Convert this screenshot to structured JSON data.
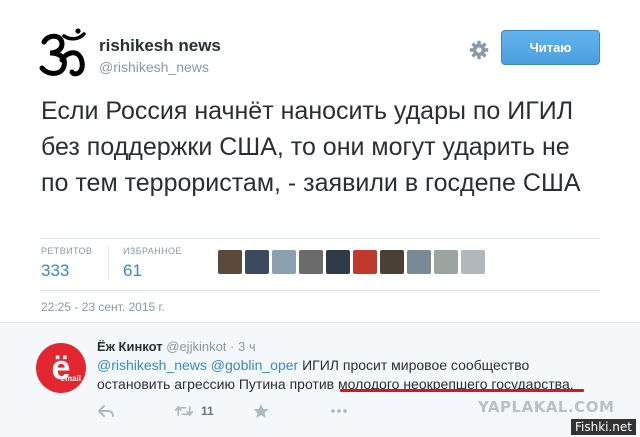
{
  "tweet": {
    "author_name": "rishikesh news",
    "author_handle": "@rishikesh_news",
    "follow_label": "Читаю",
    "text": "Если Россия начнёт наносить удары по ИГИЛ без поддержки США, то они могут ударить не по тем террористам, - заявили в госдепе США",
    "stats": {
      "retweets_label": "РЕТВИТОВ",
      "retweets_value": "333",
      "favorites_label": "ИЗБРАННОЕ",
      "favorites_value": "61"
    },
    "favoriter_avatars": [
      "#5a4a3a",
      "#3b4a5e",
      "#8aa0b0",
      "#6b6b6b",
      "#2f3b48",
      "#c0392b",
      "#4a4035",
      "#7a8a95",
      "#9aa5a0",
      "#b0b8bc"
    ],
    "timestamp": "22:25 - 23 сент. 2015 г."
  },
  "reply": {
    "avatar_letter": "ё",
    "avatar_small": "email",
    "name": "Ёж Кинкот",
    "handle": "@ejjkinkot",
    "time": "· 3 ч",
    "mentions": "@rishikesh_news @goblin_oper",
    "text_line1_rest": " ИГИЛ просит мировое сообщество",
    "text_line2": "остановить агрессию Путина против молодого неокрепшего государства.",
    "retweet_count": "11"
  },
  "watermark": "YAPLAKAL.COM",
  "site_badge": "Fishki.net",
  "colors": {
    "link": "#3b88c3",
    "follow_button": "#4a9fe0",
    "reply_avatar": "#e3262f",
    "highlight_underline": "#e0151b"
  }
}
